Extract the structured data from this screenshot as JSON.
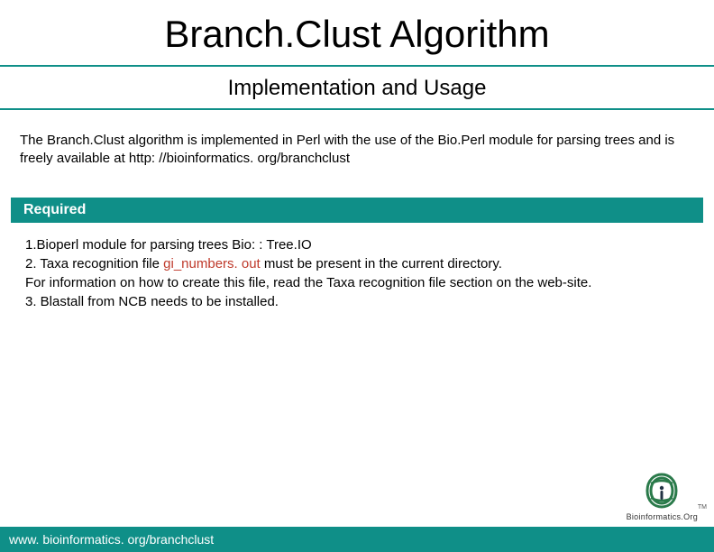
{
  "title": "Branch.Clust Algorithm",
  "subtitle": "Implementation and Usage",
  "intro": "The Branch.Clust algorithm is implemented in Perl with the use of the Bio.Perl module for parsing trees and is freely available at http: //bioinformatics. org/branchclust",
  "required_header": "Required",
  "required": {
    "item1": "1.Bioperl module for parsing trees  Bio: : Tree.IO",
    "item2_prefix": "2. Taxa recognition file ",
    "item2_highlight": "gi_numbers. out",
    "item2_suffix": " must be present in the current directory.",
    "item2_note": "For information on how to create this file, read the Taxa recognition file section on the web-site.",
    "item3": "3. Blastall from NCB needs to be installed."
  },
  "footer_url": "www. bioinformatics. org/branchclust",
  "logo_caption": "Bioinformatics.Org",
  "logo_tm": "TM"
}
